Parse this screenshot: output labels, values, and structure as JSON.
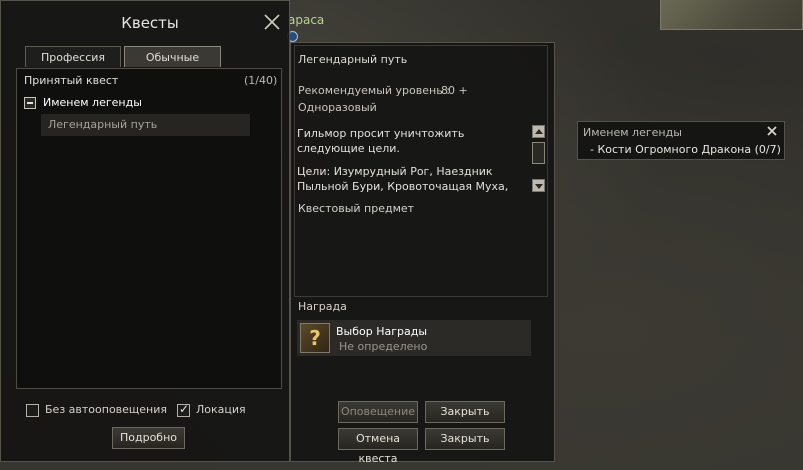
{
  "background": {
    "chat_text": "араса"
  },
  "quest_window": {
    "title": "Квесты",
    "tabs": [
      {
        "label": "Профессия",
        "active": false
      },
      {
        "label": "Обычные",
        "active": true
      }
    ],
    "accepted_label": "Принятый квест",
    "accepted_count": "(1/40)",
    "category": {
      "label": "Именем легенды",
      "expanded": true
    },
    "quests": [
      {
        "name": "Легендарный путь",
        "selected": true
      }
    ],
    "options": {
      "no_autonotify": {
        "label": "Без автооповещения",
        "checked": false
      },
      "location": {
        "label": "Локация",
        "checked": true
      }
    },
    "details_button": "Подробно"
  },
  "quest_details": {
    "title": "Легендарный путь",
    "recommended_level_label": "Рекомендуемый уровень :",
    "recommended_level_value": "80 +",
    "repeat_type": "Одноразовый",
    "description": "Гильмор просит уничтожить следующие цели.",
    "targets": "Цели: Изумрудный Рог, Наездник Пыльной Бури, Кровоточащая Муха, Черное Лезвие",
    "quest_item_label": "Квестовый предмет",
    "reward_label": "Награда",
    "reward": {
      "name": "Выбор Награды",
      "status": "Не определено",
      "icon": "question-mark-icon"
    },
    "buttons": {
      "notify": "Оповещение",
      "close_top": "Закрыть",
      "abandon": "Отмена квеста",
      "close_bottom": "Закрыть"
    }
  },
  "tracker": {
    "title": "Именем легенды",
    "objective": "- Кости Огромного Дракона (0/7)"
  },
  "colors": {
    "panel_bg": "#141413",
    "border": "#55534b",
    "accent_green": "#b7d48c",
    "reward_gold": "#e8c66a"
  }
}
